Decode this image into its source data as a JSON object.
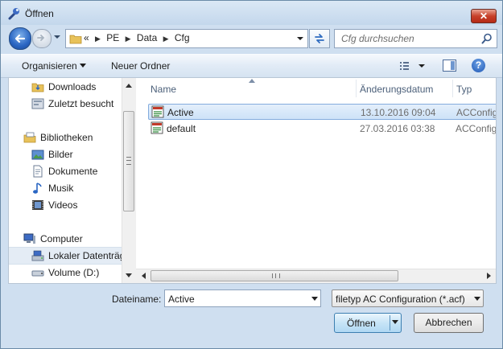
{
  "window": {
    "title": "Öffnen",
    "close_glyph": "✕"
  },
  "navbar": {
    "breadcrumb_prefix": "«",
    "breadcrumbs": [
      "PE",
      "Data",
      "Cfg"
    ],
    "crumb_separator": "▶",
    "search_placeholder": "Cfg durchsuchen"
  },
  "toolbar": {
    "organize_label": "Organisieren",
    "new_folder_label": "Neuer Ordner",
    "help_glyph": "?"
  },
  "sidebar": {
    "items": [
      {
        "label": "Downloads",
        "icon": "downloads-folder-icon"
      },
      {
        "label": "Zuletzt besucht",
        "icon": "recent-places-icon"
      },
      {
        "label": "Bibliotheken",
        "icon": "libraries-icon"
      },
      {
        "label": "Bilder",
        "icon": "pictures-icon"
      },
      {
        "label": "Dokumente",
        "icon": "documents-icon"
      },
      {
        "label": "Musik",
        "icon": "music-icon"
      },
      {
        "label": "Videos",
        "icon": "videos-icon"
      },
      {
        "label": "Computer",
        "icon": "computer-icon"
      },
      {
        "label": "Lokaler Datenträger",
        "icon": "local-disk-icon"
      },
      {
        "label": "Volume (D:)",
        "icon": "drive-icon"
      }
    ],
    "selected": "Lokaler Datenträger"
  },
  "filelist": {
    "columns": [
      "Name",
      "Änderungsdatum",
      "Typ"
    ],
    "rows": [
      {
        "name": "Active",
        "date": "13.10.2016 09:04",
        "type": "ACConfig",
        "selected": true
      },
      {
        "name": "default",
        "date": "27.03.2016 03:38",
        "type": "ACConfig",
        "selected": false
      }
    ]
  },
  "footer": {
    "filename_label": "Dateiname:",
    "filename_value": "Active",
    "filter_value": "filetyp AC Configuration (*.acf)",
    "open_label": "Öffnen",
    "cancel_label": "Abbrechen"
  },
  "colors": {
    "selection_bg": "#cde2f8",
    "selection_border": "#84acdd",
    "title_bg": "#c3d7ec",
    "close_red": "#c7402a"
  }
}
